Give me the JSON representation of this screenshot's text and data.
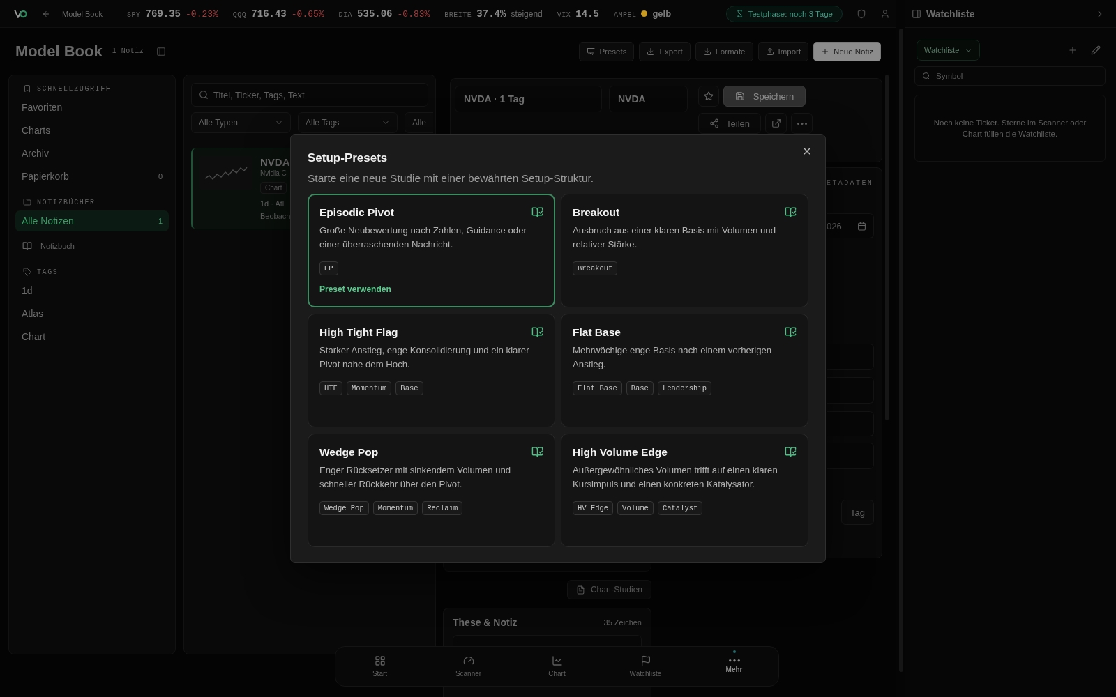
{
  "top_bar": {
    "back_label": "Model Book",
    "tickers": [
      {
        "symbol": "SPY",
        "value": "769.35",
        "change": "-0.23%"
      },
      {
        "symbol": "QQQ",
        "value": "716.43",
        "change": "-0.65%"
      },
      {
        "symbol": "DIA",
        "value": "535.06",
        "change": "-0.83%"
      }
    ],
    "breadth": {
      "label": "BREITE",
      "value": "37.4%",
      "trend": "steigend"
    },
    "vix": {
      "label": "VIX",
      "value": "14.5"
    },
    "signal": {
      "label": "AMPEL",
      "value": "gelb",
      "color": "#c99a1e"
    },
    "trial_badge": "Testphase: noch 3 Tage"
  },
  "page_header": {
    "title": "Model Book",
    "count": "1 Notiz",
    "buttons": [
      {
        "label": "Presets",
        "kind": "presets"
      },
      {
        "label": "Export",
        "kind": "export"
      },
      {
        "label": "Formate",
        "kind": "formats"
      },
      {
        "label": "Import",
        "kind": "import"
      },
      {
        "label": "Neue Notiz",
        "kind": "primary"
      }
    ]
  },
  "sidebar": {
    "sections": [
      {
        "heading": "SCHNELLZUGRIFF",
        "kind": "quick",
        "items": [
          {
            "label": "Favoriten",
            "kind": "link",
            "selected": false
          },
          {
            "label": "Charts",
            "kind": "link",
            "selected": false
          },
          {
            "label": "Archiv",
            "kind": "link",
            "selected": false
          },
          {
            "label": "Papierkorb",
            "kind": "link",
            "count": "0",
            "selected": false
          }
        ]
      },
      {
        "heading": "NOTIZBÜCHER",
        "kind": "notebooks",
        "items": [
          {
            "label": "Alle Notizen",
            "kind": "link",
            "count": "1",
            "selected": true
          },
          {
            "label": "Notizbuch",
            "kind": "notebook",
            "selected": false
          }
        ]
      },
      {
        "heading": "TAGS",
        "kind": "tags",
        "items": [
          {
            "label": "1d",
            "kind": "link",
            "selected": false
          },
          {
            "label": "Atlas",
            "kind": "link",
            "selected": false
          },
          {
            "label": "Chart",
            "kind": "link",
            "selected": false
          }
        ]
      }
    ]
  },
  "notes_panel": {
    "search_placeholder": "Titel, Ticker, Tags, Text",
    "filters": [
      "Alle Typen",
      "Alle Tags",
      "Alle"
    ],
    "notes": [
      {
        "title": "NVDA",
        "subtitle": "Nvidia C",
        "tag": "Chart",
        "meta": "1d · Atl",
        "status": "Beobach",
        "selected": true
      }
    ]
  },
  "editor": {
    "title_value": "NVDA · 1 Tag",
    "ticker_value": "NVDA",
    "save_label": "Speichern",
    "share_label": "Teilen",
    "metadata_heading": "ETADATEN",
    "date_value": "026",
    "tag_button": "Tag",
    "chart_studies_label": "Chart-Studien",
    "thesis": {
      "title": "These & Notiz",
      "count": "35 Zeichen"
    }
  },
  "watchlist": {
    "title": "Watchliste",
    "list_name": "Watchliste",
    "search_placeholder": "Symbol",
    "empty_text": "Noch keine Ticker. Sterne im Scanner oder Chart füllen die Watchliste."
  },
  "bottom_nav": [
    {
      "label": "Start",
      "kind": "home",
      "selected": false
    },
    {
      "label": "Scanner",
      "kind": "scanner",
      "selected": false
    },
    {
      "label": "Chart",
      "kind": "chart",
      "selected": false
    },
    {
      "label": "Watchliste",
      "kind": "watchlist",
      "selected": false
    },
    {
      "label": "Mehr",
      "kind": "more",
      "selected": true
    }
  ],
  "dialog": {
    "title": "Setup-Presets",
    "subtitle": "Starte eine neue Studie mit einer bewährten Setup-Struktur.",
    "action_label": "Preset verwenden",
    "presets": [
      {
        "name": "Episodic Pivot",
        "description": "Große Neubewertung nach Zahlen, Guidance oder einer überraschenden Nachricht.",
        "tags": [
          "EP"
        ],
        "selected": true
      },
      {
        "name": "Breakout",
        "description": "Ausbruch aus einer klaren Basis mit Volumen und relativer Stärke.",
        "tags": [
          "Breakout"
        ],
        "selected": false
      },
      {
        "name": "High Tight Flag",
        "description": "Starker Anstieg, enge Konsolidierung und ein klarer Pivot nahe dem Hoch.",
        "tags": [
          "HTF",
          "Momentum",
          "Base"
        ],
        "selected": false
      },
      {
        "name": "Flat Base",
        "description": "Mehrwöchige enge Basis nach einem vorherigen Anstieg.",
        "tags": [
          "Flat Base",
          "Base",
          "Leadership"
        ],
        "selected": false
      },
      {
        "name": "Wedge Pop",
        "description": "Enger Rücksetzer mit sinkendem Volumen und schneller Rückkehr über den Pivot.",
        "tags": [
          "Wedge Pop",
          "Momentum",
          "Reclaim"
        ],
        "selected": false
      },
      {
        "name": "High Volume Edge",
        "description": "Außergewöhnliches Volumen trifft auf einen klaren Kursimpuls und einen konkreten Katalysator.",
        "tags": [
          "HV Edge",
          "Volume",
          "Catalyst"
        ],
        "selected": false
      }
    ]
  }
}
